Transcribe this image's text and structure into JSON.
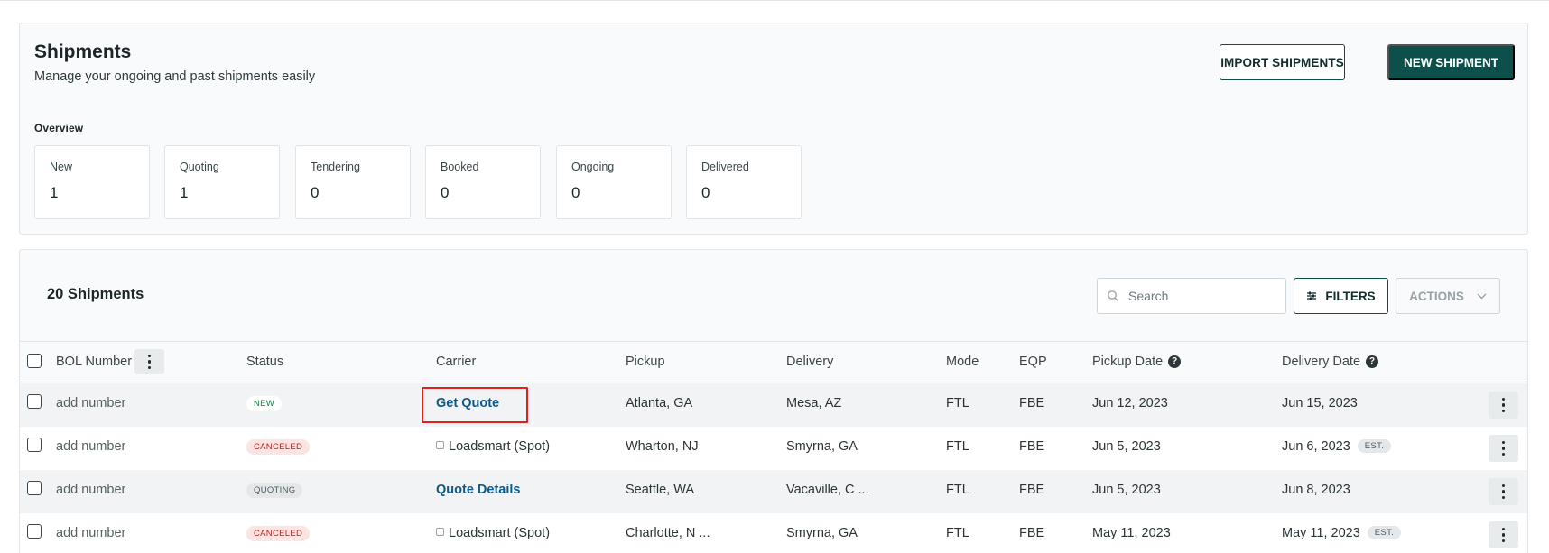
{
  "header": {
    "title": "Shipments",
    "subtitle": "Manage your ongoing and past shipments easily",
    "import_label": "IMPORT SHIPMENTS",
    "new_label": "NEW SHIPMENT"
  },
  "overview": {
    "label": "Overview",
    "stats": [
      {
        "label": "New",
        "value": "1"
      },
      {
        "label": "Quoting",
        "value": "1"
      },
      {
        "label": "Tendering",
        "value": "0"
      },
      {
        "label": "Booked",
        "value": "0"
      },
      {
        "label": "Ongoing",
        "value": "0"
      },
      {
        "label": "Delivered",
        "value": "0"
      }
    ]
  },
  "table": {
    "count_title": "20 Shipments",
    "search_placeholder": "Search",
    "filters_label": "FILTERS",
    "actions_label": "ACTIONS",
    "columns": {
      "bol": "BOL Number",
      "status": "Status",
      "carrier": "Carrier",
      "pickup": "Pickup",
      "delivery": "Delivery",
      "mode": "Mode",
      "eqp": "EQP",
      "pickup_date": "Pickup Date",
      "delivery_date": "Delivery Date"
    },
    "rows": [
      {
        "bol": "add number",
        "status": "NEW",
        "carrier": "Get Quote",
        "pickup": "Atlanta, GA",
        "delivery": "Mesa, AZ",
        "mode": "FTL",
        "eqp": "FBE",
        "pickup_date": "Jun 12, 2023",
        "delivery_date": "Jun 15, 2023",
        "est": ""
      },
      {
        "bol": "add number",
        "status": "CANCELED",
        "carrier": "Loadsmart (Spot)",
        "pickup": "Wharton, NJ",
        "delivery": "Smyrna, GA",
        "mode": "FTL",
        "eqp": "FBE",
        "pickup_date": "Jun 5, 2023",
        "delivery_date": "Jun 6, 2023",
        "est": "EST."
      },
      {
        "bol": "add number",
        "status": "QUOTING",
        "carrier": "Quote Details",
        "pickup": "Seattle, WA",
        "delivery": "Vacaville, C ...",
        "mode": "FTL",
        "eqp": "FBE",
        "pickup_date": "Jun 5, 2023",
        "delivery_date": "Jun 8, 2023",
        "est": ""
      },
      {
        "bol": "add number",
        "status": "CANCELED",
        "carrier": "Loadsmart (Spot)",
        "pickup": "Charlotte, N ...",
        "delivery": "Smyrna, GA",
        "mode": "FTL",
        "eqp": "FBE",
        "pickup_date": "May 11, 2023",
        "delivery_date": "May 11, 2023",
        "est": "EST."
      }
    ]
  },
  "colors": {
    "primary": "#0c4f4b",
    "link": "#0d5a8a",
    "highlight": "#e0211b",
    "canceled_bg": "#fde3e1",
    "canceled_text": "#b3261e",
    "new_text": "#1e7a4c"
  },
  "icons": [
    "search-icon",
    "filter-icon",
    "chevron-down-icon",
    "help-icon",
    "kebab-menu-icon",
    "carrier-icon"
  ]
}
